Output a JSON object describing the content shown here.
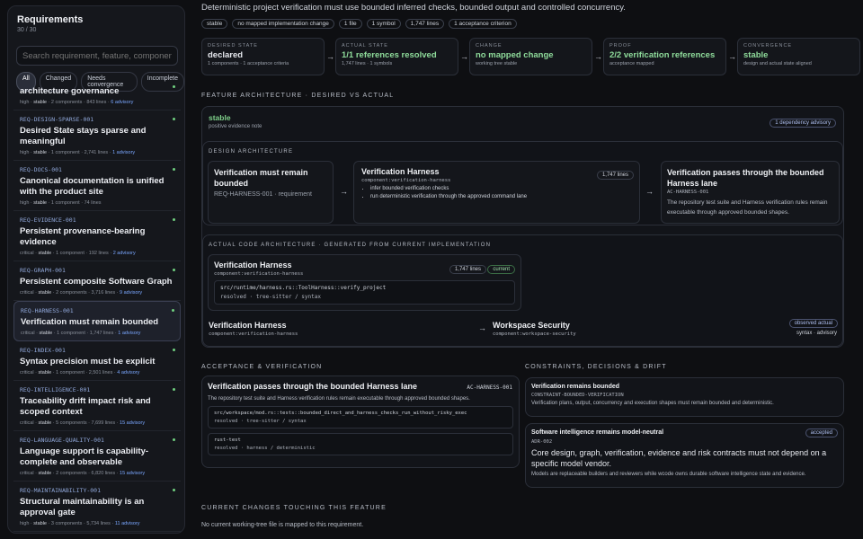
{
  "sidebar": {
    "title": "Requirements",
    "count": "30 / 30",
    "search_placeholder": "Search requirement, feature, component...",
    "filters": [
      "All",
      "Changed",
      "Needs convergence",
      "Incomplete"
    ],
    "items": [
      {
        "id": "",
        "title": "architecture governance",
        "priority": "high",
        "state": "stable",
        "components": "2 components",
        "lines": "843 lines",
        "advisory": "6 advisory"
      },
      {
        "id": "REQ-DESIGN-SPARSE-001",
        "title": "Desired State stays sparse and meaningful",
        "priority": "high",
        "state": "stable",
        "components": "1 component",
        "lines": "2,741 lines",
        "advisory": "1 advisory"
      },
      {
        "id": "REQ-DOCS-001",
        "title": "Canonical documentation is unified with the product site",
        "priority": "high",
        "state": "stable",
        "components": "1 component",
        "lines": "74 lines",
        "advisory": ""
      },
      {
        "id": "REQ-EVIDENCE-001",
        "title": "Persistent provenance-bearing evidence",
        "priority": "critical",
        "state": "stable",
        "components": "1 component",
        "lines": "192 lines",
        "advisory": "2 advisory"
      },
      {
        "id": "REQ-GRAPH-001",
        "title": "Persistent composite Software Graph",
        "priority": "critical",
        "state": "stable",
        "components": "2 components",
        "lines": "3,716 lines",
        "advisory": "9 advisory"
      },
      {
        "id": "REQ-HARNESS-001",
        "title": "Verification must remain bounded",
        "priority": "critical",
        "state": "stable",
        "components": "1 component",
        "lines": "1,747 lines",
        "advisory": "1 advisory"
      },
      {
        "id": "REQ-INDEX-001",
        "title": "Syntax precision must be explicit",
        "priority": "critical",
        "state": "stable",
        "components": "1 component",
        "lines": "2,501 lines",
        "advisory": "4 advisory"
      },
      {
        "id": "REQ-INTELLIGENCE-001",
        "title": "Traceability drift impact risk and scoped context",
        "priority": "critical",
        "state": "stable",
        "components": "5 components",
        "lines": "7,699 lines",
        "advisory": "15 advisory"
      },
      {
        "id": "REQ-LANGUAGE-QUALITY-001",
        "title": "Language support is capability-complete and observable",
        "priority": "critical",
        "state": "stable",
        "components": "2 components",
        "lines": "6,820 lines",
        "advisory": "15 advisory"
      },
      {
        "id": "REQ-MAINTAINABILITY-001",
        "title": "Structural maintainability is an approval gate",
        "priority": "high",
        "state": "stable",
        "components": "3 components",
        "lines": "5,734 lines",
        "advisory": "11 advisory"
      }
    ]
  },
  "header": {
    "lead": "Deterministic project verification must use bounded inferred checks, bounded output and controlled concurrency.",
    "pills": [
      "stable",
      "no mapped implementation change",
      "1 file",
      "1 symbol",
      "1,747 lines",
      "1 acceptance criterion"
    ]
  },
  "status_cards": [
    {
      "label": "DESIRED STATE",
      "value": "declared",
      "sub": "1 components · 1 acceptance criteria",
      "color": "#e6e8ee"
    },
    {
      "label": "ACTUAL STATE",
      "value": "1/1 references resolved",
      "sub": "1,747 lines · 1 symbols",
      "color": "#8fdc9b"
    },
    {
      "label": "CHANGE",
      "value": "no mapped change",
      "sub": "working tree stable",
      "color": "#8fdc9b"
    },
    {
      "label": "PROOF",
      "value": "2/2 verification references",
      "sub": "acceptance mapped",
      "color": "#8fdc9b"
    },
    {
      "label": "CONVERGENCE",
      "value": "stable",
      "sub": "design and actual state aligned",
      "color": "#8fdc9b"
    }
  ],
  "feature_arch": {
    "heading": "FEATURE ARCHITECTURE · DESIRED VS ACTUAL",
    "status": "stable",
    "note": "positive evidence note",
    "badge": "1 dependency advisory",
    "design_heading": "DESIGN ARCHITECTURE",
    "req_title": "Verification must remain bounded",
    "req_sub": "REQ-HARNESS-001 · requirement",
    "comp_title": "Verification Harness",
    "comp_id": "component:verification-harness",
    "comp_lines": "1,747 lines",
    "comp_bullets": [
      "infer bounded verification checks",
      "run deterministic verification through the approved command lane"
    ],
    "ac_title": "Verification passes through the bounded Harness lane",
    "ac_id": "AC-HARNESS-001",
    "ac_desc": "The repository test suite and Harness verification rules remain executable through approved bounded shapes.",
    "actual_heading": "ACTUAL CODE ARCHITECTURE · GENERATED FROM CURRENT IMPLEMENTATION",
    "actual_title": "Verification Harness",
    "actual_id": "component:verification-harness",
    "actual_lines": "1,747 lines",
    "actual_status": "current",
    "actual_path": "src/runtime/harness.rs::ToolHarness::verify_project",
    "actual_resolved": "resolved · tree-sitter / syntax",
    "dep_from_title": "Verification Harness",
    "dep_from_id": "component:verification-harness",
    "dep_to_title": "Workspace Security",
    "dep_to_id": "component:workspace-security",
    "dep_badge": "observed actual",
    "dep_sub": "syntax · advisory"
  },
  "acceptance": {
    "heading": "ACCEPTANCE & VERIFICATION",
    "title": "Verification passes through the bounded Harness lane",
    "id": "AC-HARNESS-001",
    "desc": "The repository test suite and Harness verification rules remain executable through approved bounded shapes.",
    "refs": [
      {
        "path": "src/workspace/mod.rs::tests::bounded_direct_and_harness_checks_run_without_risky_exec",
        "resolved": "resolved · tree-sitter / syntax"
      },
      {
        "path": "rust-test",
        "resolved": "resolved · harness / deterministic"
      }
    ]
  },
  "constraints": {
    "heading": "CONSTRAINTS, DECISIONS & DRIFT",
    "items": [
      {
        "title": "Verification remains bounded",
        "id": "CONSTRAINT-BOUNDED-VERIFICATION",
        "desc": "Verification plans, output, concurrency and execution shapes must remain bounded and deterministic."
      },
      {
        "title": "Software intelligence remains model-neutral",
        "id": "ADR-002",
        "badge": "accepted",
        "lead": "Core design, graph, verification, evidence and risk contracts must not depend on a specific model vendor.",
        "desc": "Models are replaceable builders and reviewers while wcode owns durable software intelligence state and evidence."
      }
    ]
  },
  "changes": {
    "heading": "CURRENT CHANGES TOUCHING THIS FEATURE",
    "text": "No current working-tree file is mapped to this requirement."
  }
}
